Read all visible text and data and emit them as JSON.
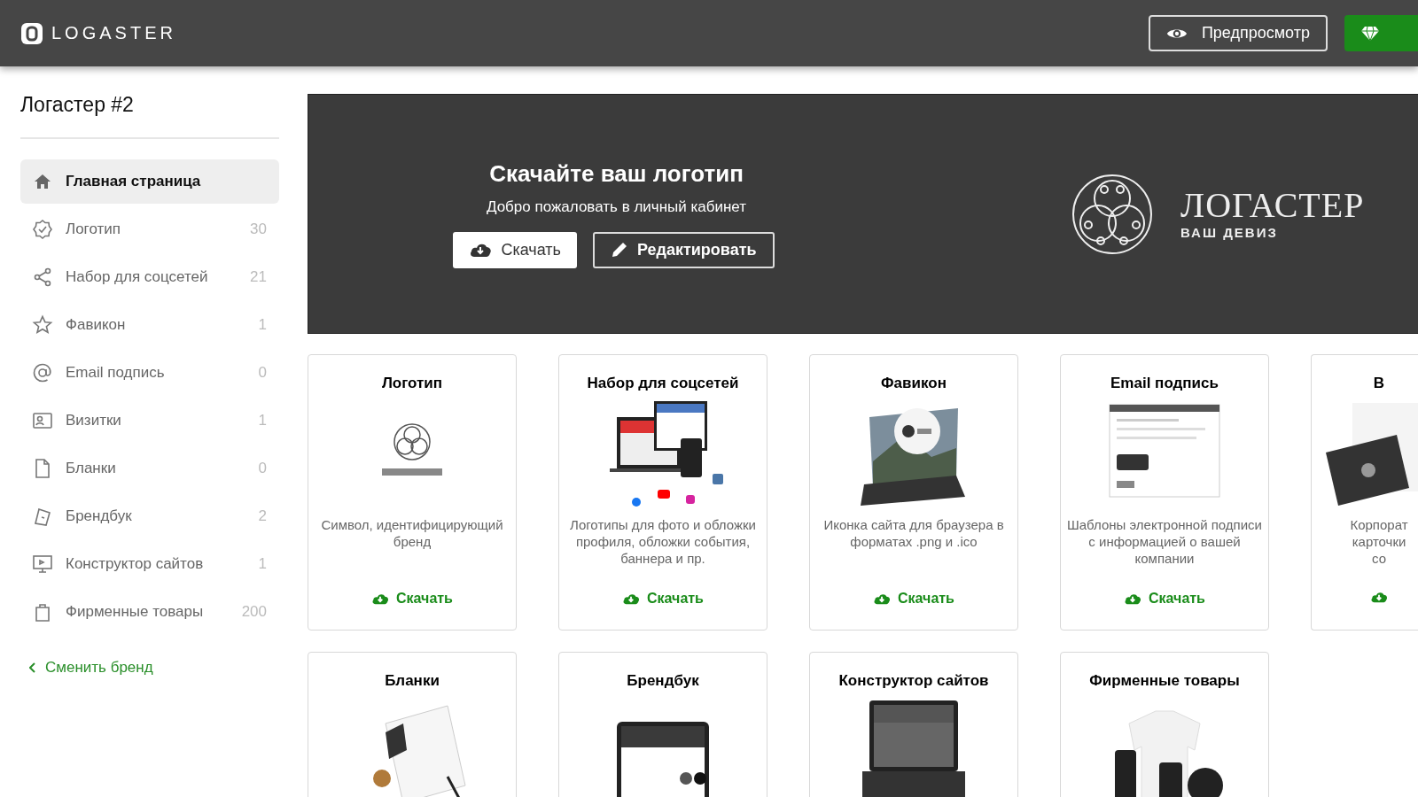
{
  "header": {
    "brand": "LOGASTER",
    "preview_button": "Предпросмотр"
  },
  "sidebar": {
    "title": "Логастер #2",
    "items": [
      {
        "label": "Главная страница",
        "selected": true
      },
      {
        "label": "Логотип",
        "count": "30",
        "selected": false
      },
      {
        "label": "Набор для соцсетей",
        "count": "21",
        "selected": false
      },
      {
        "label": "Фавикон",
        "count": "1",
        "selected": false
      },
      {
        "label": "Email подпись",
        "count": "0",
        "selected": false
      },
      {
        "label": "Визитки",
        "count": "1",
        "selected": false
      },
      {
        "label": "Бланки",
        "count": "0",
        "selected": false
      },
      {
        "label": "Брендбук",
        "count": "2",
        "selected": false
      },
      {
        "label": "Конструктор сайтов",
        "count": "1",
        "selected": false
      },
      {
        "label": "Фирменные товары",
        "count": "200",
        "selected": false
      }
    ],
    "change_brand": "Сменить бренд"
  },
  "banner": {
    "title": "Скачайте ваш логотип",
    "subtitle": "Добро пожаловать в личный кабинет",
    "download_button": "Скачать",
    "edit_button": "Редактировать",
    "logo_name": "ЛОГАСТЕР",
    "logo_slogan": "ВАШ ДЕВИЗ"
  },
  "cards": [
    {
      "title": "Логотип",
      "description": "Символ, идентифицирующий бренд",
      "download": "Скачать"
    },
    {
      "title": "Набор для соцсетей",
      "description": "Логотипы для фото и обложки профиля, обложки события, баннера и пр.",
      "download": "Скачать"
    },
    {
      "title": "Фавикон",
      "description": "Иконка сайта для браузера в форматах .png и .ico",
      "download": "Скачать"
    },
    {
      "title": "Email подпись",
      "description": "Шаблоны электронной подписи с информацией о вашей компании",
      "download": "Скачать"
    },
    {
      "title": "В",
      "description": "Корпорат карточки со"
    },
    {
      "title": "Бланки"
    },
    {
      "title": "Брендбук"
    },
    {
      "title": "Конструктор сайтов"
    },
    {
      "title": "Фирменные товары"
    }
  ]
}
